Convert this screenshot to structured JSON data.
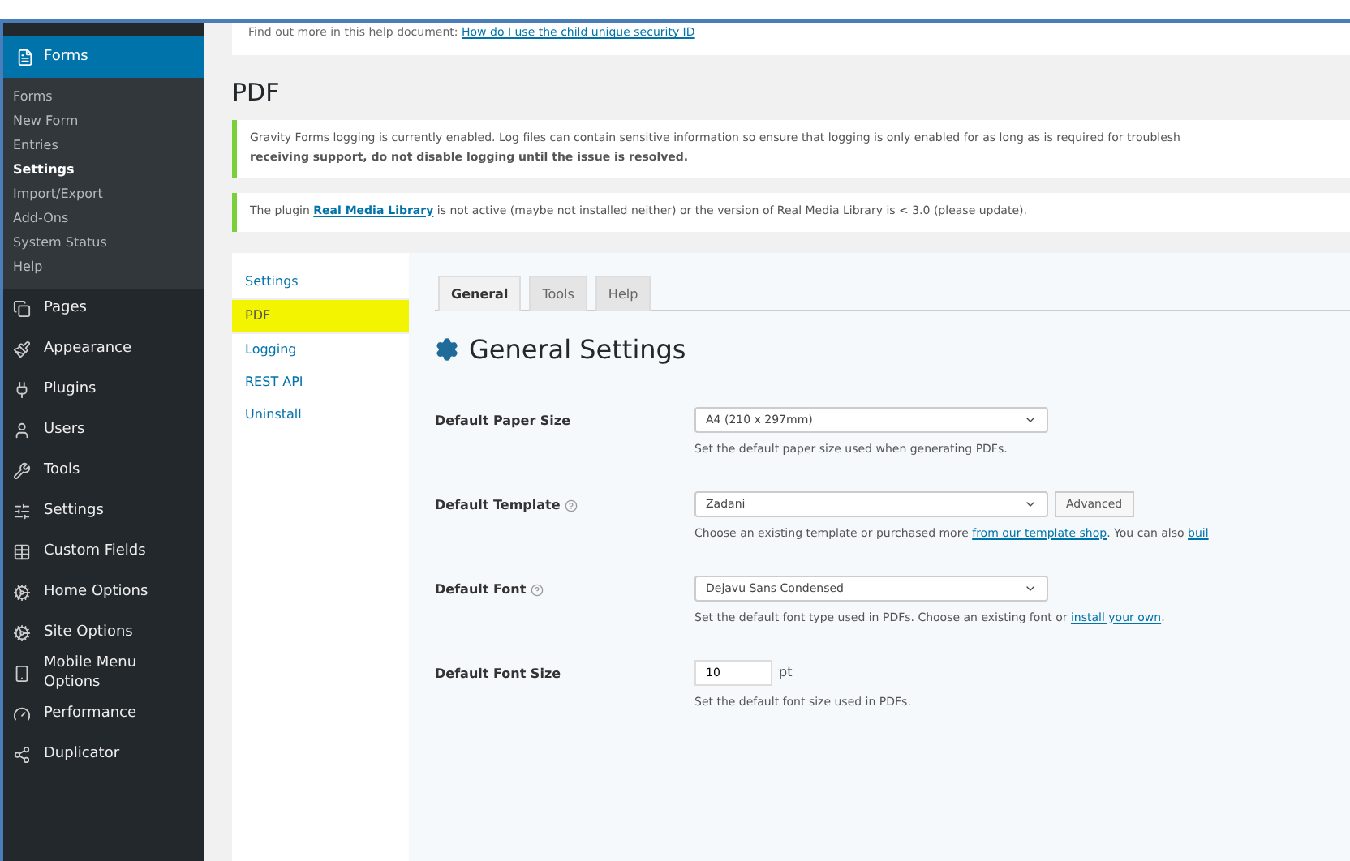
{
  "admin_menu": {
    "submenu": [
      {
        "label": "Forms",
        "selected": false
      },
      {
        "label": "New Form",
        "selected": false
      },
      {
        "label": "Entries",
        "selected": false
      },
      {
        "label": "Settings",
        "selected": true
      },
      {
        "label": "Import/Export",
        "selected": false
      },
      {
        "label": "Add-Ons",
        "selected": false
      },
      {
        "label": "System Status",
        "selected": false
      },
      {
        "label": "Help",
        "selected": false
      }
    ],
    "items": [
      {
        "label": "Forms",
        "selected": true
      },
      {
        "label": "Pages",
        "selected": false
      },
      {
        "label": "Appearance",
        "selected": false
      },
      {
        "label": "Plugins",
        "selected": false
      },
      {
        "label": "Users",
        "selected": false
      },
      {
        "label": "Tools",
        "selected": false
      },
      {
        "label": "Settings",
        "selected": false
      },
      {
        "label": "Custom Fields",
        "selected": false
      },
      {
        "label": "Home Options",
        "selected": false
      },
      {
        "label": "Site Options",
        "selected": false
      },
      {
        "label": "Mobile Menu Options",
        "selected": false
      },
      {
        "label": "Performance",
        "selected": false
      },
      {
        "label": "Duplicator",
        "selected": false
      }
    ]
  },
  "top_note": {
    "text": "Find out more in this help document:",
    "link": "How do I use the child unique security ID"
  },
  "page_title": "PDF",
  "notices": [
    {
      "text": "Gravity Forms logging is currently enabled. Log files can contain sensitive information so ensure that logging is only enabled for as long as is required for troublesh",
      "bold": "receiving support, do not disable logging until the issue is resolved."
    },
    {
      "before": "The plugin ",
      "link": "Real Media Library",
      "after": " is not active (maybe not installed neither) or the version of Real Media Library is < 3.0 (please update)."
    }
  ],
  "settings_nav": [
    {
      "label": "Settings",
      "selected": false,
      "highlighted": false
    },
    {
      "label": "PDF",
      "selected": true,
      "highlighted": true
    },
    {
      "label": "Logging",
      "selected": false,
      "highlighted": false
    },
    {
      "label": "REST API",
      "selected": false,
      "highlighted": false
    },
    {
      "label": "Uninstall",
      "selected": false,
      "highlighted": false
    }
  ],
  "tabs": [
    {
      "label": "General",
      "selected": true
    },
    {
      "label": "Tools",
      "selected": false
    },
    {
      "label": "Help",
      "selected": false
    }
  ],
  "section_title": "General Settings",
  "fields": [
    {
      "kind": "select",
      "label": "Default Paper Size",
      "help_icon": false,
      "value": "A4 (210 x 297mm)",
      "description": {
        "text": "Set the default paper size used when generating PDFs."
      }
    },
    {
      "kind": "select",
      "label": "Default Template",
      "help_icon": true,
      "value": "Zadani",
      "button": "Advanced",
      "description": {
        "text": "Choose an existing template or purchased more ",
        "link": "from our template shop",
        "after": ". You can also ",
        "link2": "buil"
      }
    },
    {
      "kind": "select",
      "label": "Default Font",
      "help_icon": true,
      "value": "Dejavu Sans Condensed",
      "description": {
        "text": "Set the default font type used in PDFs. Choose an existing font or ",
        "link": "install your own",
        "after": "."
      }
    },
    {
      "kind": "number",
      "label": "Default Font Size",
      "help_icon": false,
      "value": "10",
      "unit": "pt",
      "description": {
        "text": "Set the default font size used in PDFs."
      }
    }
  ]
}
